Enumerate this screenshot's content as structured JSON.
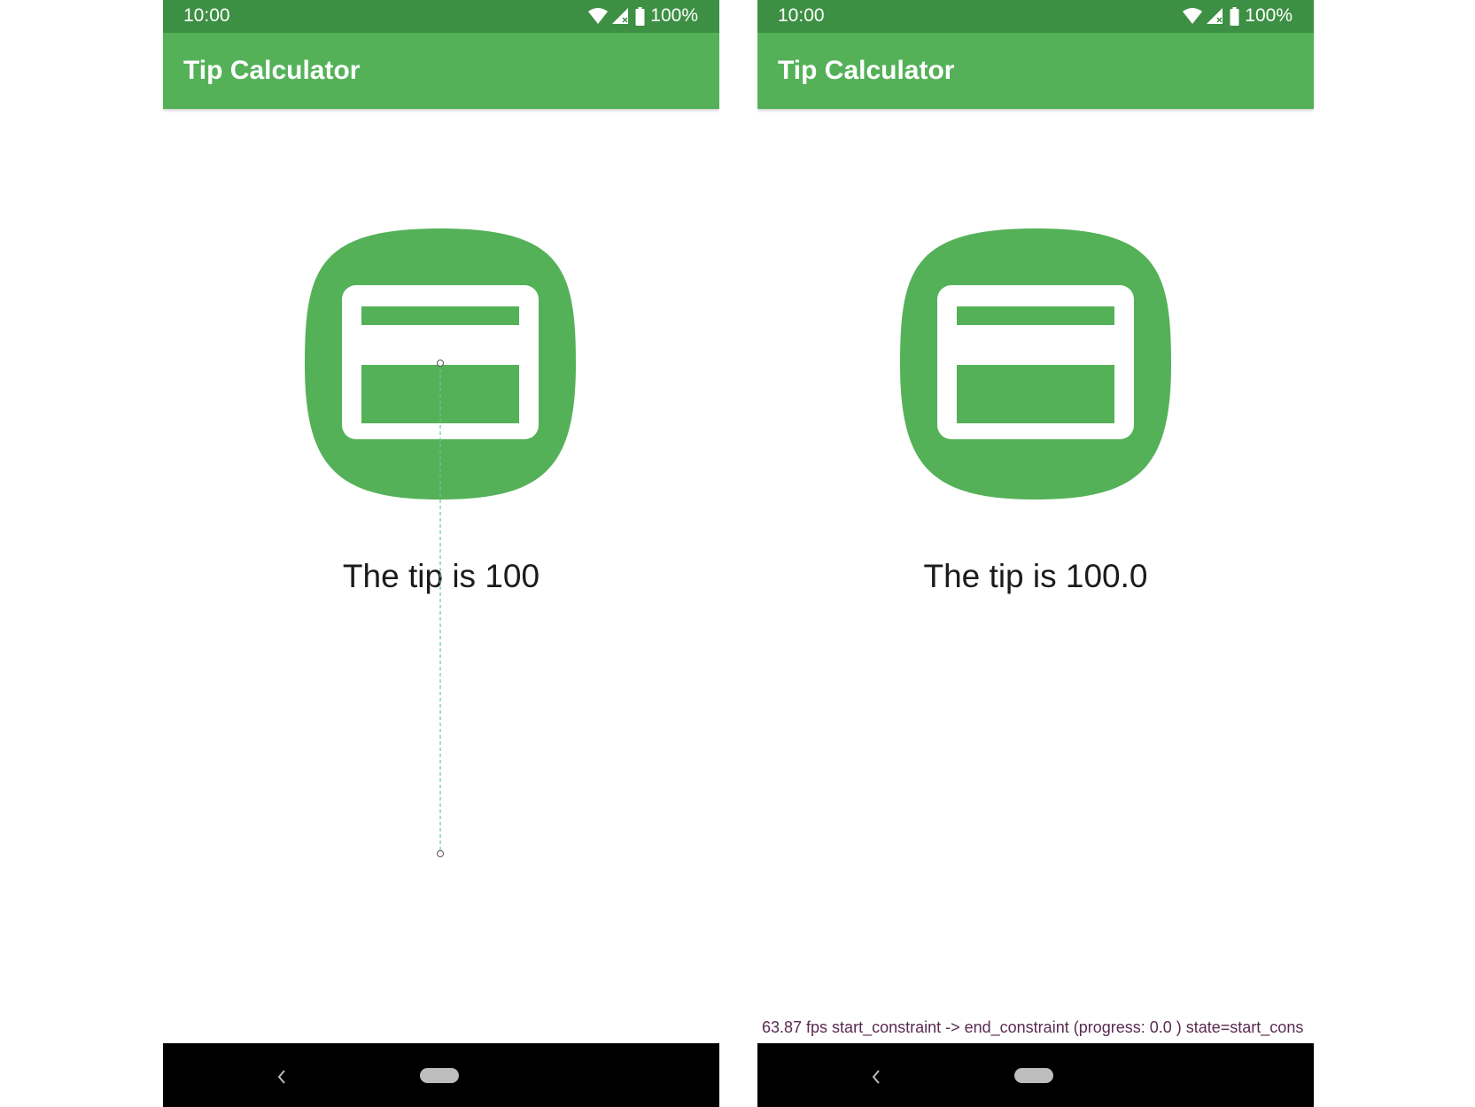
{
  "screens": [
    {
      "status_bar": {
        "time": "10:00",
        "battery": "100%",
        "icons": [
          "wifi-icon",
          "cell-signal-icon",
          "battery-icon"
        ]
      },
      "app_bar": {
        "title": "Tip Calculator"
      },
      "app_icon": "credit-card-icon",
      "tip_text": "The tip is 100",
      "motion_path_visible": true,
      "nav_bar": {
        "icons": [
          "back-icon",
          "home-pill-icon"
        ]
      }
    },
    {
      "status_bar": {
        "time": "10:00",
        "battery": "100%",
        "icons": [
          "wifi-icon",
          "cell-signal-icon",
          "battery-icon"
        ]
      },
      "app_bar": {
        "title": "Tip Calculator"
      },
      "app_icon": "credit-card-icon",
      "tip_text": "The tip is 100.0",
      "debug_overlay": "63.87 fps start_constraint -> end_constraint (progress: 0.0 ) state=start_cons",
      "nav_bar": {
        "icons": [
          "back-icon",
          "home-pill-icon"
        ]
      }
    }
  ],
  "colors": {
    "status_bar": "#3d8f43",
    "app_bar": "#54b158",
    "icon_green": "#54b158",
    "nav_bar": "#000000",
    "text": "#1b1b1b",
    "debug_text": "#5a2a52"
  }
}
